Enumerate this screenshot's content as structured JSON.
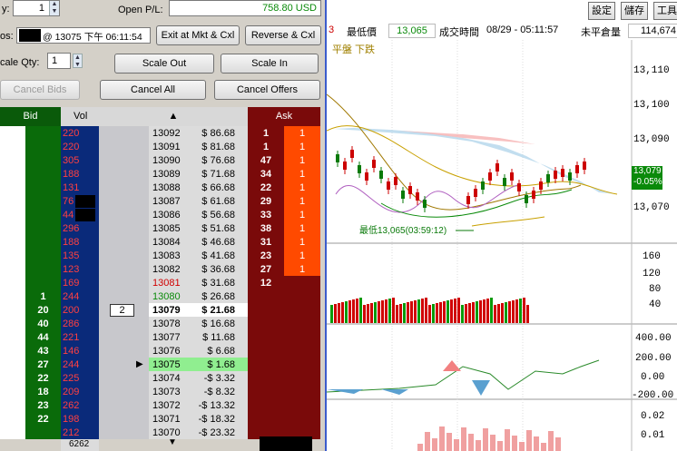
{
  "top": {
    "qty_label": "y:",
    "qty_value": "1",
    "open_pl_label": "Open P/L:",
    "open_pl_value": "758.80 USD",
    "pos_label": "os:",
    "pos_value": "@ 13075 下午 06:11:54",
    "exit_btn": "Exit at Mkt & Cxl",
    "reverse_btn": "Reverse & Cxl",
    "scale_qty_label": "cale Qty:",
    "scale_qty_value": "1",
    "scale_out": "Scale Out",
    "scale_in": "Scale In",
    "cancel_bids": "Cancel Bids",
    "cancel_all": "Cancel All",
    "cancel_offers": "Cancel Offers"
  },
  "ladder": {
    "bid_header": "Bid",
    "vol_header": "Vol",
    "ask_header": "Ask",
    "footer_vol": "6262",
    "order_qty": "2",
    "rows": [
      {
        "bid": "",
        "vol": "220",
        "price": "13092",
        "pl": "$ 86.68",
        "ask": "1",
        "ask2": "1"
      },
      {
        "bid": "",
        "vol": "220",
        "price": "13091",
        "pl": "$ 81.68",
        "ask": "1",
        "ask2": "1"
      },
      {
        "bid": "",
        "vol": "305",
        "price": "13090",
        "pl": "$ 76.68",
        "ask": "47",
        "ask2": "1"
      },
      {
        "bid": "",
        "vol": "188",
        "price": "13089",
        "pl": "$ 71.68",
        "ask": "34",
        "ask2": "1"
      },
      {
        "bid": "",
        "vol": "131",
        "price": "13088",
        "pl": "$ 66.68",
        "ask": "22",
        "ask2": "1"
      },
      {
        "bid": "",
        "vol": "76",
        "price": "13087",
        "pl": "$ 61.68",
        "ask": "29",
        "ask2": "1"
      },
      {
        "bid": "",
        "vol": "44",
        "price": "13086",
        "pl": "$ 56.68",
        "ask": "33",
        "ask2": "1"
      },
      {
        "bid": "",
        "vol": "296",
        "price": "13085",
        "pl": "$ 51.68",
        "ask": "38",
        "ask2": "1"
      },
      {
        "bid": "",
        "vol": "188",
        "price": "13084",
        "pl": "$ 46.68",
        "ask": "31",
        "ask2": "1"
      },
      {
        "bid": "",
        "vol": "135",
        "price": "13083",
        "pl": "$ 41.68",
        "ask": "23",
        "ask2": "1"
      },
      {
        "bid": "",
        "vol": "123",
        "price": "13082",
        "pl": "$ 36.68",
        "ask": "27",
        "ask2": "1"
      },
      {
        "bid": "",
        "vol": "169",
        "price": "13081",
        "pl": "$ 31.68",
        "ask": "12",
        "ask2": ""
      },
      {
        "bid": "1",
        "vol": "244",
        "price": "13080",
        "pl": "$ 26.68",
        "ask": "",
        "ask2": ""
      },
      {
        "bid": "20",
        "vol": "200",
        "price": "13079",
        "pl": "$ 21.68",
        "ask": "",
        "ask2": ""
      },
      {
        "bid": "40",
        "vol": "286",
        "price": "13078",
        "pl": "$ 16.68",
        "ask": "",
        "ask2": ""
      },
      {
        "bid": "44",
        "vol": "221",
        "price": "13077",
        "pl": "$ 11.68",
        "ask": "",
        "ask2": ""
      },
      {
        "bid": "43",
        "vol": "146",
        "price": "13076",
        "pl": "$ 6.68",
        "ask": "",
        "ask2": ""
      },
      {
        "bid": "27",
        "vol": "244",
        "price": "13075",
        "pl": "$ 1.68",
        "ask": "",
        "ask2": ""
      },
      {
        "bid": "22",
        "vol": "225",
        "price": "13074",
        "pl": "-$ 3.32",
        "ask": "",
        "ask2": ""
      },
      {
        "bid": "18",
        "vol": "209",
        "price": "13073",
        "pl": "-$ 8.32",
        "ask": "",
        "ask2": ""
      },
      {
        "bid": "23",
        "vol": "262",
        "price": "13072",
        "pl": "-$ 13.32",
        "ask": "",
        "ask2": ""
      },
      {
        "bid": "22",
        "vol": "198",
        "price": "13071",
        "pl": "-$ 18.32",
        "ask": "",
        "ask2": ""
      },
      {
        "bid": "",
        "vol": "212",
        "price": "13070",
        "pl": "-$ 23.32",
        "ask": "",
        "ask2": ""
      }
    ]
  },
  "quote": {
    "prev_frag": "3",
    "low_label": "最低價",
    "low_value": "13,065",
    "time_label": "成交時間",
    "time_value": "08/29 - 05:11:57",
    "oi_label": "未平倉量",
    "oi_value": "114,674",
    "btn_settings": "設定",
    "btn_save": "儲存",
    "btn_tools": "工具",
    "mode_text": "平盤  下跌"
  },
  "chart": {
    "price_ticks": [
      "13,110",
      "13,100",
      "13,090",
      "13,070"
    ],
    "last_price": "13,079",
    "last_change": "-0.05%",
    "low_annotation": "最低13,065(03:59:12)",
    "vol_ticks": [
      "160",
      "120",
      "80",
      "40"
    ],
    "osc1_ticks": [
      "400.00",
      "200.00",
      "0.00",
      "-200.00"
    ],
    "osc2_ticks": [
      "0.02",
      "0.01"
    ]
  },
  "colors": {
    "bid_green": "#0a6b0a",
    "ask_dark": "#7a0a0a",
    "ask_orange": "#ff4a00",
    "vol_red": "#d00000",
    "current_price_row": "#90ee90"
  }
}
